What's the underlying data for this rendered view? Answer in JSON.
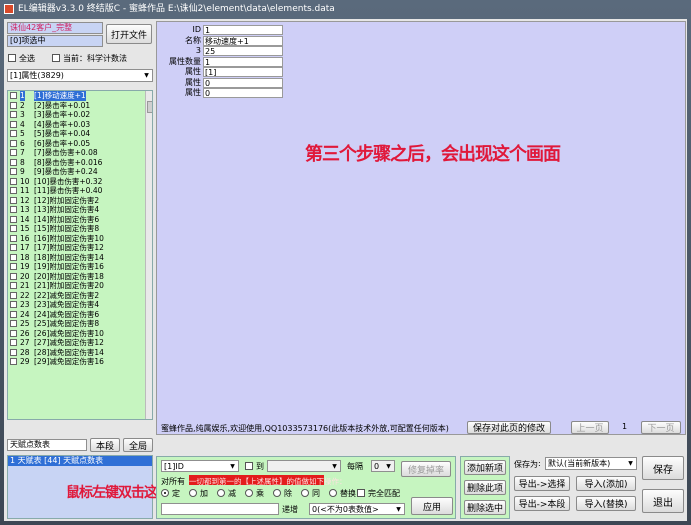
{
  "window": {
    "title": "EL编辑器v3.3.0 终结版C  -  蜜蜂作品  E:\\诛仙2\\element\\data\\elements.data"
  },
  "left": {
    "client_label": "诛仙42客户_完整",
    "selected_label": "[0]项选中",
    "open_file_label": "打开文件",
    "select_all_label": "全选",
    "current_label": "当前：科学计数法",
    "category_value": "[1]属性(3829)",
    "items": [
      {
        "n": "1",
        "t": "[1]移动速度+1",
        "sel": true
      },
      {
        "n": "2",
        "t": "[2]暴击率+0.01"
      },
      {
        "n": "3",
        "t": "[3]暴击率+0.02"
      },
      {
        "n": "4",
        "t": "[4]暴击率+0.03"
      },
      {
        "n": "5",
        "t": "[5]暴击率+0.04"
      },
      {
        "n": "6",
        "t": "[6]暴击率+0.05"
      },
      {
        "n": "7",
        "t": "[7]暴击伤害+0.08"
      },
      {
        "n": "8",
        "t": "[8]暴击伤害+0.016"
      },
      {
        "n": "9",
        "t": "[9]暴击伤害+0.24"
      },
      {
        "n": "10",
        "t": "[10]暴击伤害+0.32"
      },
      {
        "n": "11",
        "t": "[11]暴击伤害+0.40"
      },
      {
        "n": "12",
        "t": "[12]附加固定伤害2"
      },
      {
        "n": "13",
        "t": "[13]附加固定伤害4"
      },
      {
        "n": "14",
        "t": "[14]附加固定伤害6"
      },
      {
        "n": "15",
        "t": "[15]附加固定伤害8"
      },
      {
        "n": "16",
        "t": "[16]附加固定伤害10"
      },
      {
        "n": "17",
        "t": "[17]附加固定伤害12"
      },
      {
        "n": "18",
        "t": "[18]附加固定伤害14"
      },
      {
        "n": "19",
        "t": "[19]附加固定伤害16"
      },
      {
        "n": "20",
        "t": "[20]附加固定伤害18"
      },
      {
        "n": "21",
        "t": "[21]附加固定伤害20"
      },
      {
        "n": "22",
        "t": "[22]减免固定伤害2"
      },
      {
        "n": "23",
        "t": "[23]减免固定伤害4"
      },
      {
        "n": "24",
        "t": "[24]减免固定伤害6"
      },
      {
        "n": "25",
        "t": "[25]减免固定伤害8"
      },
      {
        "n": "26",
        "t": "[26]减免固定伤害10"
      },
      {
        "n": "27",
        "t": "[27]减免固定伤害12"
      },
      {
        "n": "28",
        "t": "[28]减免固定伤害14"
      },
      {
        "n": "29",
        "t": "[29]减免固定伤害16"
      }
    ],
    "search_value": "天赋点数表",
    "search_button": "本段",
    "global_button": "全局",
    "result_item": "1 天赋表  [44] 天赋点数表",
    "hint": "鼠标左键双击这里"
  },
  "properties": [
    {
      "label": "ID",
      "value": "1"
    },
    {
      "label": "名称",
      "value": "移动速度+1"
    },
    {
      "label": "3",
      "value": "25"
    },
    {
      "label": "属性数量",
      "value": "1"
    },
    {
      "label": "属性",
      "value": "[1]"
    },
    {
      "label": "属性",
      "value": "0"
    },
    {
      "label": "属性",
      "value": "0"
    }
  ],
  "annotation": "第三个步骤之后，会出现这个画面",
  "status": {
    "text": "蜜蜂作品,纯属娱乐,欢迎使用,QQ1033573176(此版本技术外放,可配置任何版本)",
    "save_compare_button": "保存对此页的修改",
    "prev_button": "上一页",
    "page": "1",
    "next_button": "下一页"
  },
  "bottom": {
    "field_value": "[1]ID",
    "to_label": "到",
    "every_label": "每隔",
    "every_value": "0",
    "fix_button": "修复掉率",
    "all_prefix": "对所有",
    "red_text": "一切都到第一的【上述属性】的值做如下操作：",
    "ops": [
      "定",
      "加",
      "减",
      "乘",
      "除",
      "同",
      "替换"
    ],
    "exact_label": "完全匹配",
    "apply_button": "应用",
    "recurse_label": "递增",
    "recurse_value": "0(<不为0表数值>",
    "add_button": "添加新项",
    "delete_button": "删除此项",
    "delete_sel_button": "删除选中",
    "save_as_label": "保存为",
    "save_as_value": "默认(当前新版本)",
    "export_sel_button": "导出->选择",
    "import_add_button": "导入(添加)",
    "export_page_button": "导出->本段",
    "import_replace_button": "导入(替换)",
    "save_button": "保存",
    "exit_button": "退出"
  }
}
